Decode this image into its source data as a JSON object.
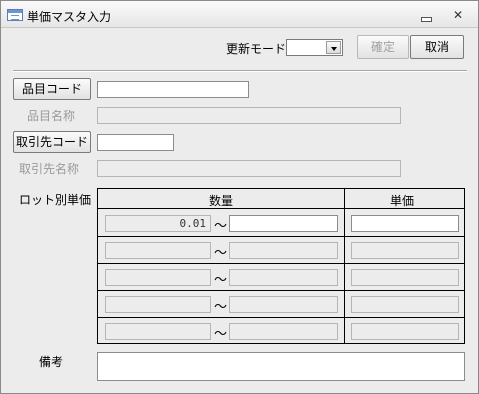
{
  "window": {
    "title": "単価マスタ入力",
    "minimize_symbol": "",
    "close_symbol": "✕"
  },
  "header": {
    "mode_label": "更新モード",
    "mode_value": "",
    "confirm_label": "確定",
    "cancel_label": "取消"
  },
  "form": {
    "product_code_button": "品目コード",
    "product_code_value": "",
    "product_name_label": "品目名称",
    "product_name_value": "",
    "supplier_code_button": "取引先コード",
    "supplier_code_value": "",
    "supplier_name_label": "取引先名称",
    "supplier_name_value": "",
    "lot_price_label": "ロット別単価",
    "notes_label": "備考",
    "notes_value": ""
  },
  "lot_table": {
    "quantity_header": "数量",
    "price_header": "単価",
    "tilde": "〜",
    "rows": [
      {
        "from": "0.01",
        "to": "",
        "price": ""
      },
      {
        "from": "",
        "to": "",
        "price": ""
      },
      {
        "from": "",
        "to": "",
        "price": ""
      },
      {
        "from": "",
        "to": "",
        "price": ""
      },
      {
        "from": "",
        "to": "",
        "price": ""
      }
    ]
  }
}
